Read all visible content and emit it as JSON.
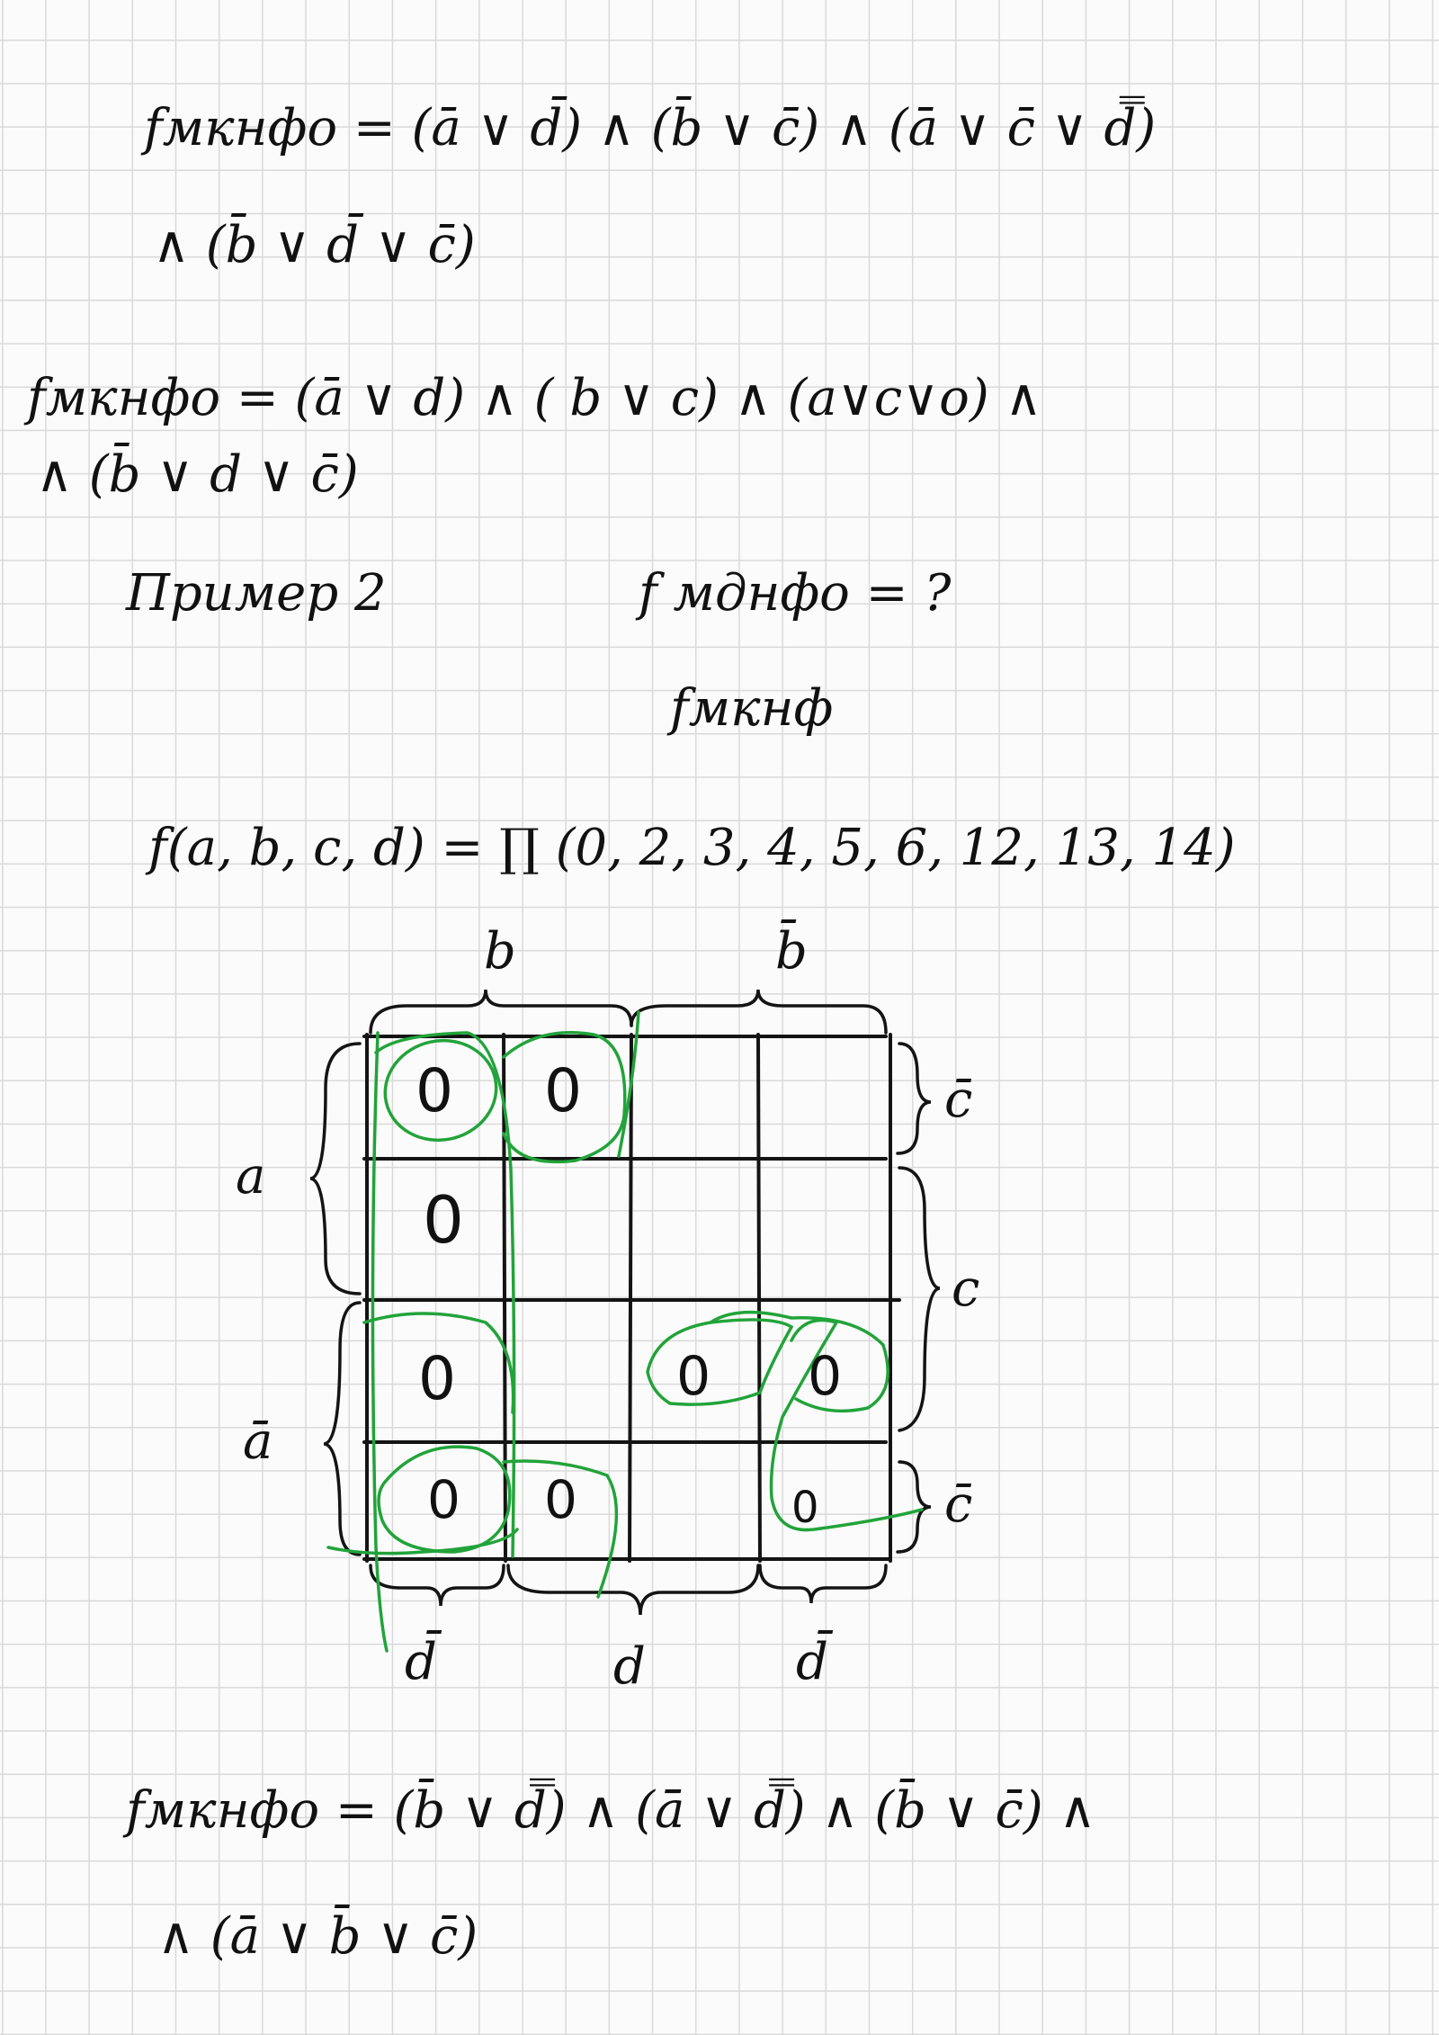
{
  "lines": [
    {
      "id": "line1a",
      "text": "fмкнфо = (ā ∨ d̄) ∧ (b̄ ∨ c̄) ∧ (ā ∨ c̄ ∨ d̿)"
    },
    {
      "id": "line1b",
      "text": "∧ (b̄ ∨ d̄ ∨ c̄)"
    },
    {
      "id": "line2a",
      "text": "fмкнфо = (ā ∨ d) ∧ ( b ∨ c) ∧ (a∨c∨o) ∧"
    },
    {
      "id": "line2b",
      "text": "∧ (b̄ ∨ d ∨ c̄)"
    },
    {
      "id": "example",
      "text": "Пример 2"
    },
    {
      "id": "question",
      "text": "f мднфо = ?"
    },
    {
      "id": "fmknf",
      "text": "fмкнф"
    },
    {
      "id": "function",
      "text": "f(a, b, c, d) = ∏ (0, 2, 3, 4, 5, 6, 12, 13, 14)"
    },
    {
      "id": "result_a",
      "text": "fмкнфо = (b̄ ∨ d̿) ∧ (ā̄ ∨ d̿) ∧ (b̄ ∨ c̄) ∧"
    },
    {
      "id": "result_b",
      "text": "∧ (ā ∨ b̄ ∨ c̄)"
    }
  ],
  "kmap": {
    "top_labels": [
      "b",
      "b̄"
    ],
    "right_labels": [
      "c̄",
      "c",
      "c̄"
    ],
    "left_labels": [
      "a",
      "ā"
    ],
    "bottom_labels": [
      "d̄",
      "d",
      "d̄"
    ],
    "cell_values": [
      [
        "0",
        "0",
        "",
        ""
      ],
      [
        "0",
        "",
        "",
        ""
      ],
      [
        "0",
        "",
        "0",
        "0"
      ],
      [
        "0",
        "0",
        "",
        "0"
      ]
    ]
  },
  "colors": {
    "ink": "#111111",
    "green": "#22a33a",
    "grid": "#d9d9d9",
    "paper": "#fbfbfb"
  }
}
